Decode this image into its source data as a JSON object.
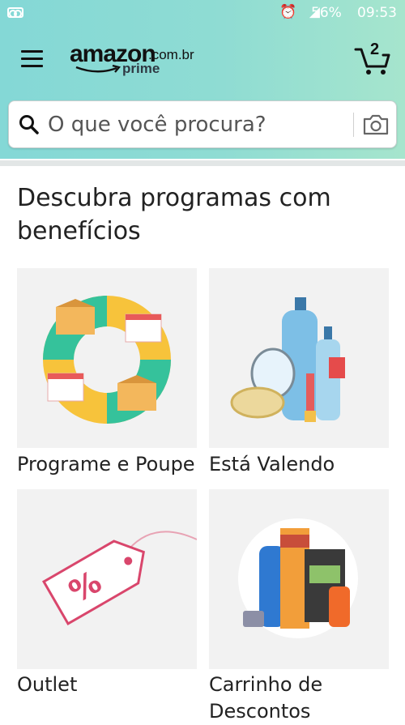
{
  "status_bar": {
    "battery": "56%",
    "time": "09:53"
  },
  "header": {
    "logo": {
      "word": "amazon",
      "tld": ".com.br",
      "sub": "prime"
    },
    "cart_count": "2"
  },
  "search": {
    "placeholder": "O que você procura?"
  },
  "section": {
    "title": "Descubra programas com benefícios"
  },
  "programs": [
    {
      "label": "Programe e Poupe",
      "icon": "subscribe-save-icon"
    },
    {
      "label": "Está Valendo",
      "icon": "beauty-products-icon"
    },
    {
      "label": "Outlet",
      "icon": "percent-tag-icon"
    },
    {
      "label": "Carrinho de Descontos",
      "icon": "household-products-icon"
    }
  ],
  "colors": {
    "header_start": "#84d8d6",
    "header_end": "#a6e5cd",
    "accent_orange": "#f39c2b"
  }
}
